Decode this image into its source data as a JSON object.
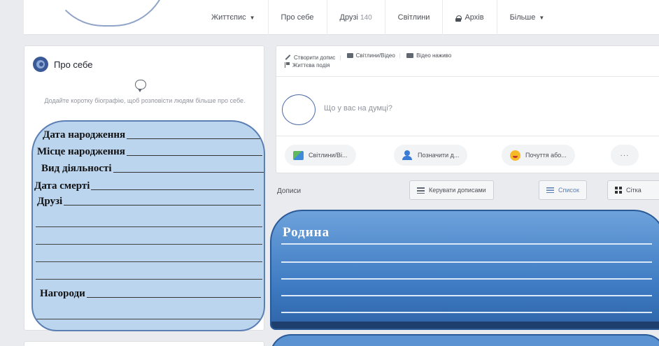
{
  "profile_nav": {
    "items": [
      {
        "label": "Життєпис",
        "caret": "▼"
      },
      {
        "label": "Про себе"
      },
      {
        "label": "Друзі",
        "count": "140"
      },
      {
        "label": "Світлини"
      },
      {
        "label": "Архів"
      },
      {
        "label": "Більше",
        "caret": "▼"
      }
    ]
  },
  "intro": {
    "title": "Про себе",
    "hint": "Додайте коротку біографію, щоб розповісти людям більше про себе.",
    "bio_fields": [
      "Дата народження",
      "Місце народження",
      "Вид діяльності",
      "Дата смерті",
      "Друзі",
      "Нагороди"
    ]
  },
  "composer": {
    "tabs": [
      "Створити допис",
      "Світлини/Відео",
      "Відео наживо",
      "Життєва подія"
    ],
    "placeholder": "Що у вас на думці?",
    "actions": [
      "Світлини/Ві...",
      "Позначити д...",
      "Почуття або..."
    ],
    "more": "···"
  },
  "posts": {
    "label": "Дописи",
    "manage_label": "Керувати дописами",
    "list_label": "Список",
    "grid_label": "Сітка"
  },
  "family": {
    "title": "Родина"
  }
}
